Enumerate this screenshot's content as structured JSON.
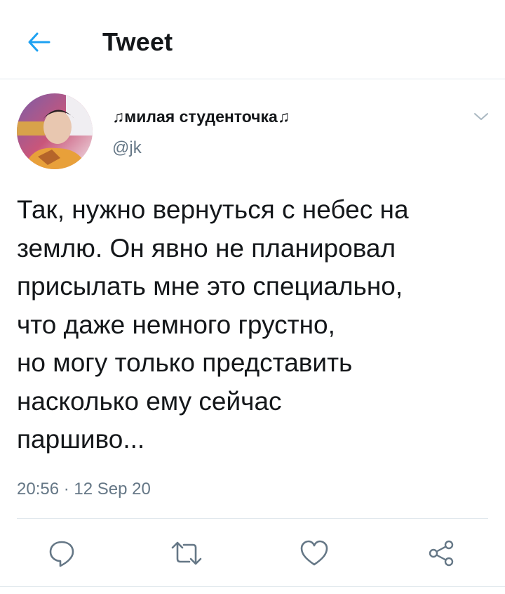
{
  "header": {
    "title": "Tweet",
    "back_icon": "arrow-left-icon"
  },
  "author": {
    "display_name": "♫милая студенточка♫",
    "handle": "@jk"
  },
  "tweet": {
    "lines": [
      "Так, нужно вернуться с небес на",
      "землю. Он явно не планировал",
      "присылать мне это специально,",
      "что даже немного грустно,",
      "но могу только представить",
      "насколько ему сейчас",
      "паршиво..."
    ],
    "timestamp": "20:56 · 12 Sep 20"
  },
  "actions": [
    "reply-icon",
    "retweet-icon",
    "like-icon",
    "share-icon"
  ],
  "colors": {
    "accent": "#1da1f2",
    "icon_gray": "#657786",
    "divider": "#e1e8ed"
  }
}
